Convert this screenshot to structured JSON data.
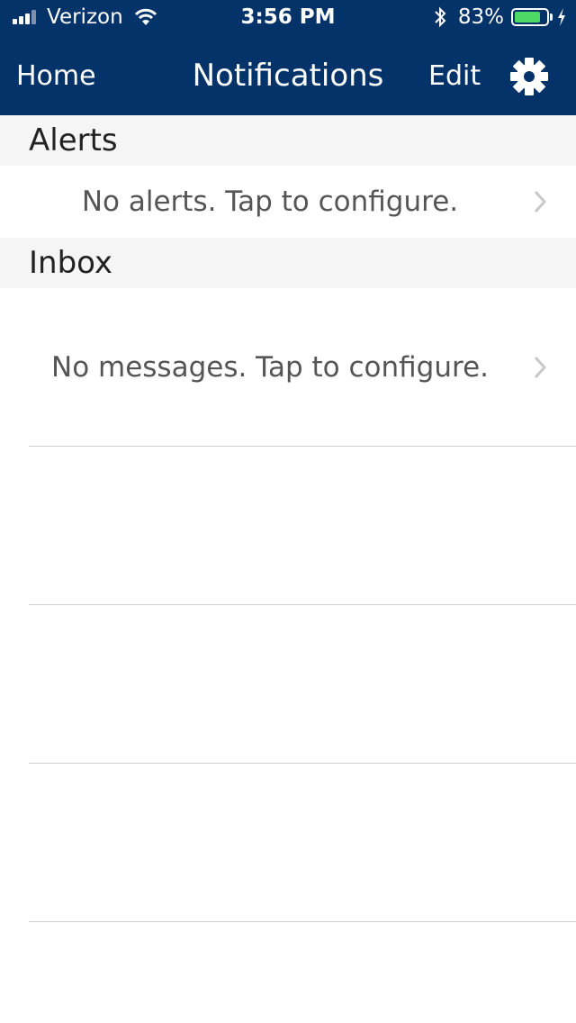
{
  "status_bar": {
    "carrier": "Verizon",
    "time": "3:56 PM",
    "battery_percent": "83%",
    "battery_level": 0.83,
    "icons": [
      "signal-icon",
      "wifi-icon",
      "bluetooth-icon",
      "battery-icon",
      "charging-icon"
    ]
  },
  "nav": {
    "home_label": "Home",
    "title": "Notifications",
    "edit_label": "Edit",
    "settings_icon": "gear-icon"
  },
  "alerts": {
    "header": "Alerts",
    "empty_text": "No alerts. Tap to configure."
  },
  "inbox": {
    "header": "Inbox",
    "empty_text": "No messages. Tap to configure."
  },
  "colors": {
    "nav_background": "#043369",
    "section_background": "#f5f5f5",
    "battery_fill": "#4cd964"
  }
}
